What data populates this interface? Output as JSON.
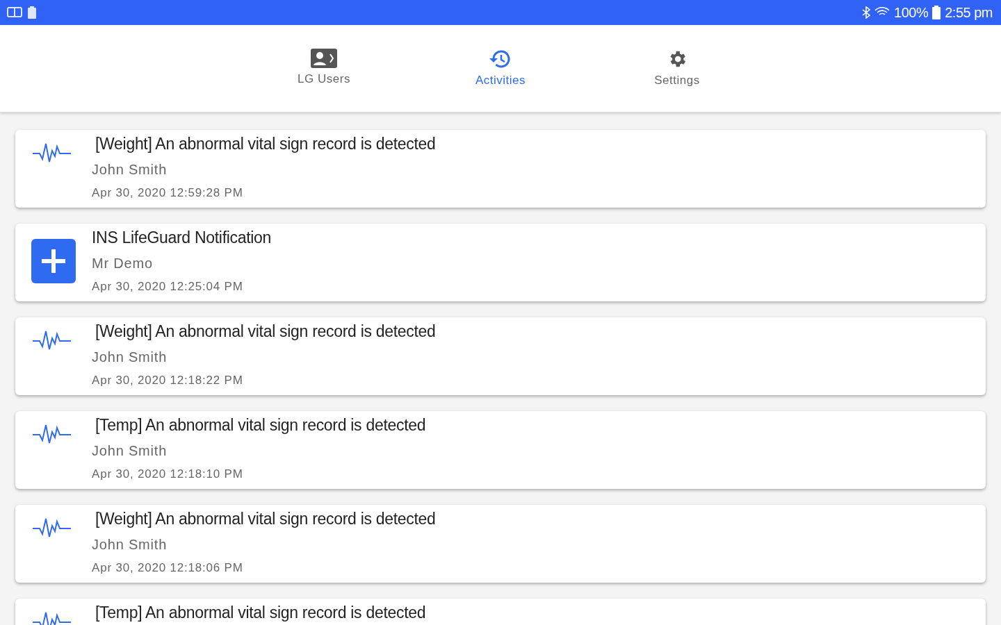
{
  "status_bar": {
    "battery": "100%",
    "time": "2:55 pm"
  },
  "tabs": [
    {
      "label": "LG Users",
      "selected": false
    },
    {
      "label": "Activities",
      "selected": true
    },
    {
      "label": "Settings",
      "selected": false
    }
  ],
  "activities": [
    {
      "kind": "vital",
      "title": "[Weight] An abnormal vital sign record is detected",
      "person": "John Smith",
      "time": "Apr 30, 2020 12:59:28 PM"
    },
    {
      "kind": "notification",
      "title": "INS LifeGuard Notification",
      "person": "Mr Demo",
      "time": "Apr 30, 2020 12:25:04 PM"
    },
    {
      "kind": "vital",
      "title": "[Weight] An abnormal vital sign record is detected",
      "person": "John Smith",
      "time": "Apr 30, 2020 12:18:22 PM"
    },
    {
      "kind": "vital",
      "title": "[Temp] An abnormal vital sign record is detected",
      "person": "John Smith",
      "time": "Apr 30, 2020 12:18:10 PM"
    },
    {
      "kind": "vital",
      "title": "[Weight] An abnormal vital sign record is detected",
      "person": "John Smith",
      "time": "Apr 30, 2020 12:18:06 PM"
    },
    {
      "kind": "vital",
      "title": "[Temp] An abnormal vital sign record is detected"
    }
  ]
}
